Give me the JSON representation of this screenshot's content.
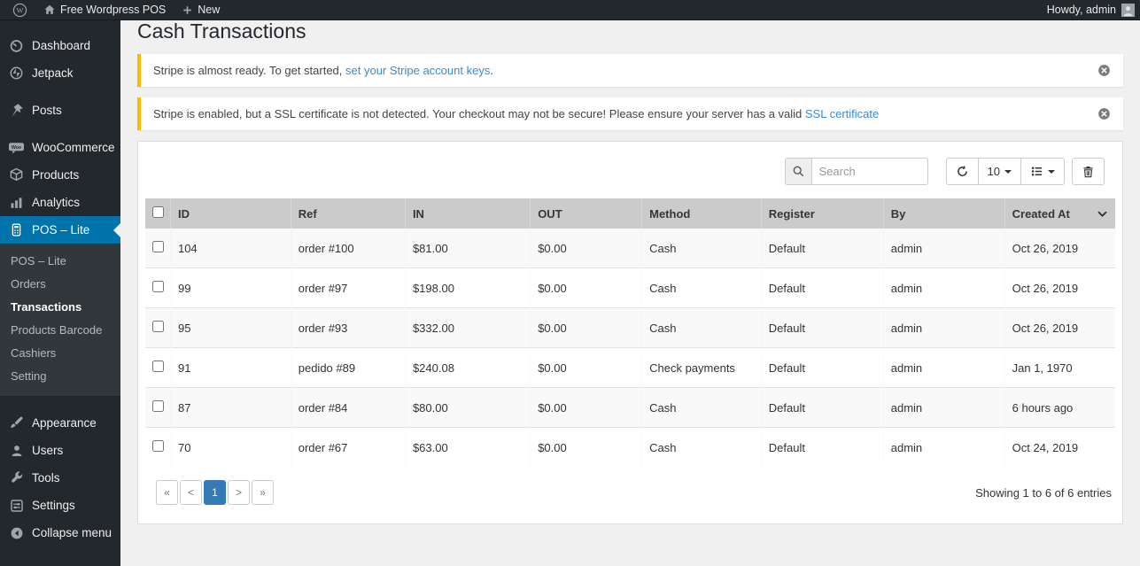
{
  "colors": {
    "accent": "#0073aa",
    "notice_border": "#ffb900",
    "pagination_active": "#337ab7",
    "link": "#3a8bcd",
    "sidebar_bg": "#23282d",
    "header_bg": "#cbcbcb"
  },
  "admin_bar": {
    "site_name": "Free Wordpress POS",
    "new_label": "New",
    "howdy": "Howdy, admin"
  },
  "sidebar": {
    "items": [
      {
        "label": "Dashboard",
        "icon": "dashboard-icon"
      },
      {
        "label": "Jetpack",
        "icon": "jetpack-icon"
      },
      {
        "label": "Posts",
        "icon": "pin-icon"
      },
      {
        "label": "WooCommerce",
        "icon": "woocommerce-icon"
      },
      {
        "label": "Products",
        "icon": "products-icon"
      },
      {
        "label": "Analytics",
        "icon": "analytics-icon"
      },
      {
        "label": "POS – Lite",
        "icon": "pos-icon",
        "active": true
      },
      {
        "label": "Appearance",
        "icon": "appearance-icon"
      },
      {
        "label": "Users",
        "icon": "users-icon"
      },
      {
        "label": "Tools",
        "icon": "tools-icon"
      },
      {
        "label": "Settings",
        "icon": "settings-icon"
      },
      {
        "label": "Collapse menu",
        "icon": "collapse-icon"
      }
    ],
    "submenu": [
      {
        "label": "POS – Lite"
      },
      {
        "label": "Orders"
      },
      {
        "label": "Transactions",
        "current": true
      },
      {
        "label": "Products Barcode"
      },
      {
        "label": "Cashiers"
      },
      {
        "label": "Setting"
      }
    ]
  },
  "page": {
    "title": "Cash Transactions"
  },
  "notices": [
    {
      "text_before": "Stripe is almost ready. To get started, ",
      "link_text": "set your Stripe account keys",
      "text_after": "."
    },
    {
      "text_before": "Stripe is enabled, but a SSL certificate is not detected. Your checkout may not be secure! Please ensure your server has a valid ",
      "link_text": "SSL certificate",
      "text_after": ""
    }
  ],
  "toolbar": {
    "search_placeholder": "Search",
    "page_size": "10"
  },
  "table": {
    "headers": [
      "ID",
      "Ref",
      "IN",
      "OUT",
      "Method",
      "Register",
      "By",
      "Created At"
    ],
    "rows": [
      {
        "id": "104",
        "ref": "order #100",
        "in": "$81.00",
        "out": "$0.00",
        "method": "Cash",
        "register": "Default",
        "by": "admin",
        "created": "Oct 26, 2019"
      },
      {
        "id": "99",
        "ref": "order #97",
        "in": "$198.00",
        "out": "$0.00",
        "method": "Cash",
        "register": "Default",
        "by": "admin",
        "created": "Oct 26, 2019"
      },
      {
        "id": "95",
        "ref": "order #93",
        "in": "$332.00",
        "out": "$0.00",
        "method": "Cash",
        "register": "Default",
        "by": "admin",
        "created": "Oct 26, 2019"
      },
      {
        "id": "91",
        "ref": "pedido #89",
        "in": "$240.08",
        "out": "$0.00",
        "method": "Check payments",
        "register": "Default",
        "by": "admin",
        "created": "Jan 1, 1970"
      },
      {
        "id": "87",
        "ref": "order #84",
        "in": "$80.00",
        "out": "$0.00",
        "method": "Cash",
        "register": "Default",
        "by": "admin",
        "created": "6 hours ago"
      },
      {
        "id": "70",
        "ref": "order #67",
        "in": "$63.00",
        "out": "$0.00",
        "method": "Cash",
        "register": "Default",
        "by": "admin",
        "created": "Oct 24, 2019"
      }
    ]
  },
  "pagination": {
    "labels": [
      "«",
      "<",
      "1",
      ">",
      "»"
    ],
    "active_index": 2
  },
  "footer": {
    "showing": "Showing 1 to 6 of 6 entries"
  }
}
